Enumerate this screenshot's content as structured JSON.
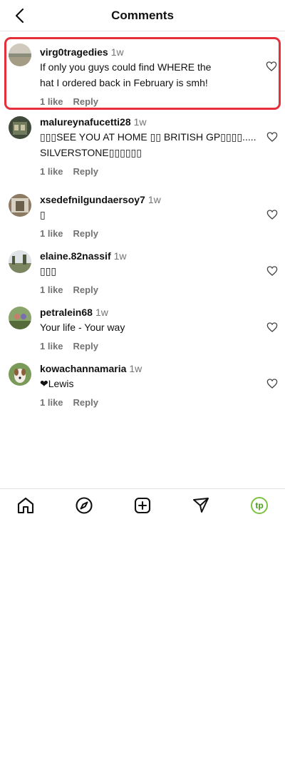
{
  "header": {
    "title": "Comments"
  },
  "comments": [
    {
      "username": "virg0tragedies",
      "time": "1w",
      "text_lines": [
        "If only you guys could find WHERE the",
        "hat I ordered back in February is smh!"
      ],
      "likes": "1 like",
      "reply": "Reply"
    },
    {
      "username": "malureynafucetti28",
      "time": "1w",
      "text_lines": [
        "▯▯▯SEE YOU AT HOME ▯▯ BRITISH GP▯▯▯▯.....",
        "SILVERSTONE▯▯▯▯▯▯"
      ],
      "likes": "1 like",
      "reply": "Reply"
    },
    {
      "username": "xsedefnilgundaersoy7",
      "time": "1w",
      "text_lines": [
        "▯"
      ],
      "likes": "1 like",
      "reply": "Reply"
    },
    {
      "username": "elaine.82nassif",
      "time": "1w",
      "text_lines": [
        "▯▯▯"
      ],
      "likes": "1 like",
      "reply": "Reply"
    },
    {
      "username": "petralein68",
      "time": "1w",
      "text_lines": [
        "Your life - Your way"
      ],
      "likes": "1 like",
      "reply": "Reply"
    },
    {
      "username": "kowachannamaria",
      "time": "1w",
      "text_lines": [
        "❤Lewis"
      ],
      "likes": "1 like",
      "reply": "Reply"
    }
  ],
  "nav": {
    "profile_initials": "tp"
  },
  "colors": {
    "highlight": "#e5303c",
    "muted": "#737373",
    "profile_ring": "#7dc242"
  }
}
